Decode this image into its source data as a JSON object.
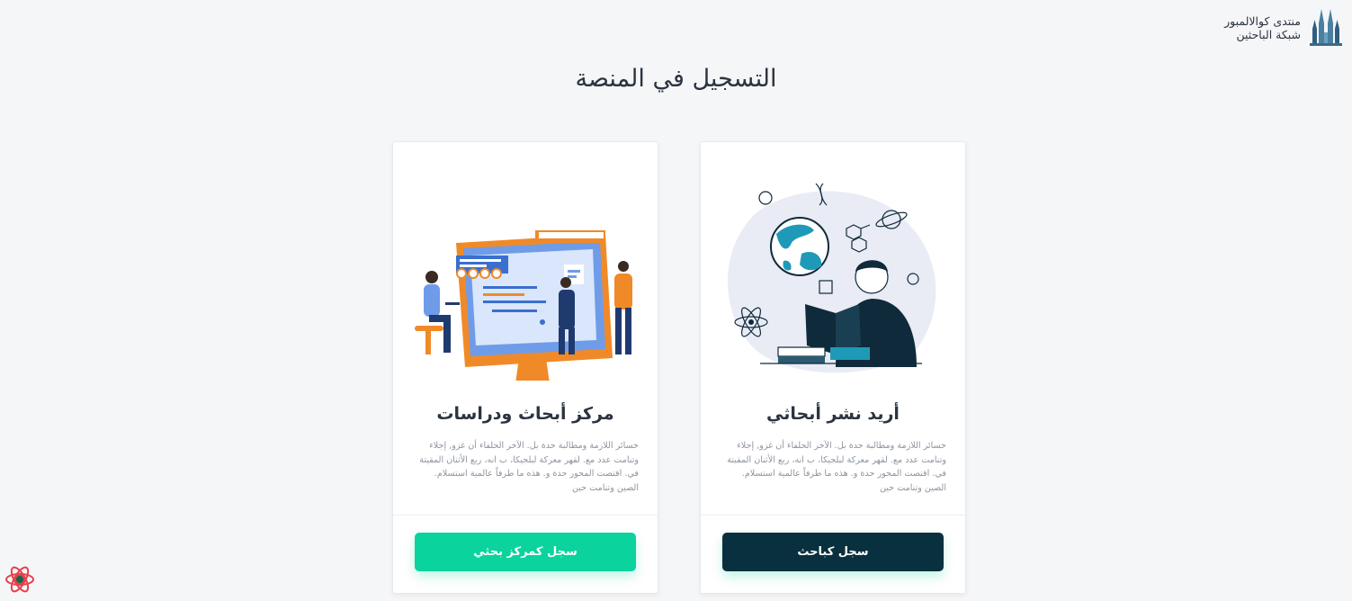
{
  "header": {
    "logo_line1": "منتدى كوالالمبور",
    "logo_line2": "شبكة الباحثين"
  },
  "page_title": "التسجيل في المنصة",
  "cards": [
    {
      "title": "مركز أبحاث ودراسات",
      "description": "خسائر اللازمة ومطالبة حدة بل. الآخر الحلفاء أن غزو, إجلاء وتنامت عدد مع. لقهر معركة لبلجيكا، ب انه، ربع الأثنان المقيتة في. اقتصت المحور حدة و. هذه ما طرفاً عالمية استسلام. الصين وتنامت حين",
      "button_label": "سجل كمركز بحثي",
      "button_color": "#0bd39d"
    },
    {
      "title": "أريد نشر أبحاثي",
      "description": "خسائر اللازمة ومطالبة حدة بل. الآخر الحلفاء أن غزو, إجلاء وتنامت عدد مع. لقهر معركة لبلجيكا، ب انه، ربع الأثنان المقيتة في. اقتصت المحور حدة و. هذه ما طرفاً عالمية استسلام. الصين وتنامت حين",
      "button_label": "سجل كباحث",
      "button_color": "#09303e"
    }
  ],
  "icons": [
    "kl-tower-logo-icon",
    "react-devtools-icon"
  ]
}
